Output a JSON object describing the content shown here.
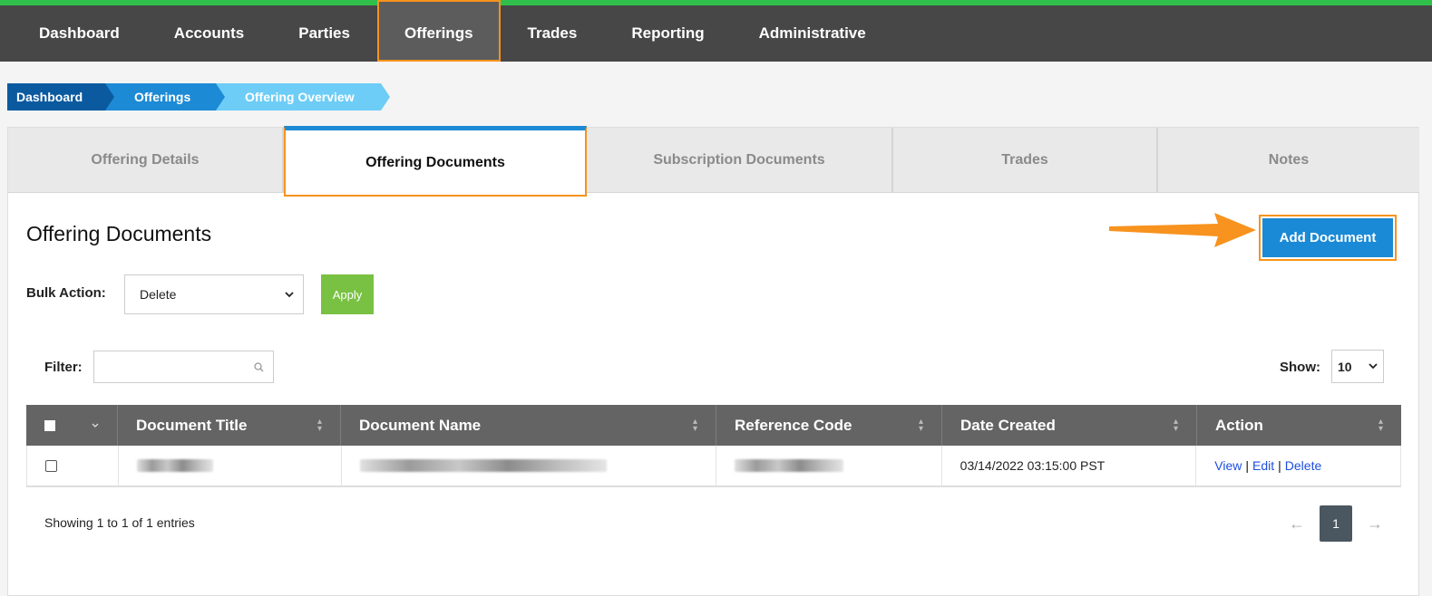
{
  "nav": {
    "items": [
      "Dashboard",
      "Accounts",
      "Parties",
      "Offerings",
      "Trades",
      "Reporting",
      "Administrative"
    ],
    "active": "Offerings"
  },
  "breadcrumb": [
    "Dashboard",
    "Offerings",
    "Offering Overview"
  ],
  "tabs": [
    "Offering Details",
    "Offering Documents",
    "Subscription Documents",
    "Trades",
    "Notes"
  ],
  "panel": {
    "title": "Offering Documents",
    "add_button": "Add Document",
    "bulk_action_label": "Bulk Action:",
    "bulk_action_value": "Delete",
    "apply_label": "Apply",
    "filter_label": "Filter:",
    "filter_placeholder": "",
    "show_label": "Show:",
    "show_value": "10"
  },
  "table": {
    "headers": [
      "Document Title",
      "Document Name",
      "Reference Code",
      "Date Created",
      "Action"
    ],
    "rows": [
      {
        "date_created": "03/14/2022 03:15:00 PST",
        "actions": [
          "View",
          "Edit",
          "Delete"
        ]
      }
    ]
  },
  "footer": {
    "showing": "Showing 1 to 1 of 1 entries",
    "prev": "←",
    "page": "1",
    "next": "→"
  },
  "colors": {
    "accent_orange": "#f7931e",
    "primary_blue": "#1a8ad6",
    "apply_green": "#79c142",
    "nav_bg": "#474747",
    "top_stripe": "#2fbf4a"
  }
}
